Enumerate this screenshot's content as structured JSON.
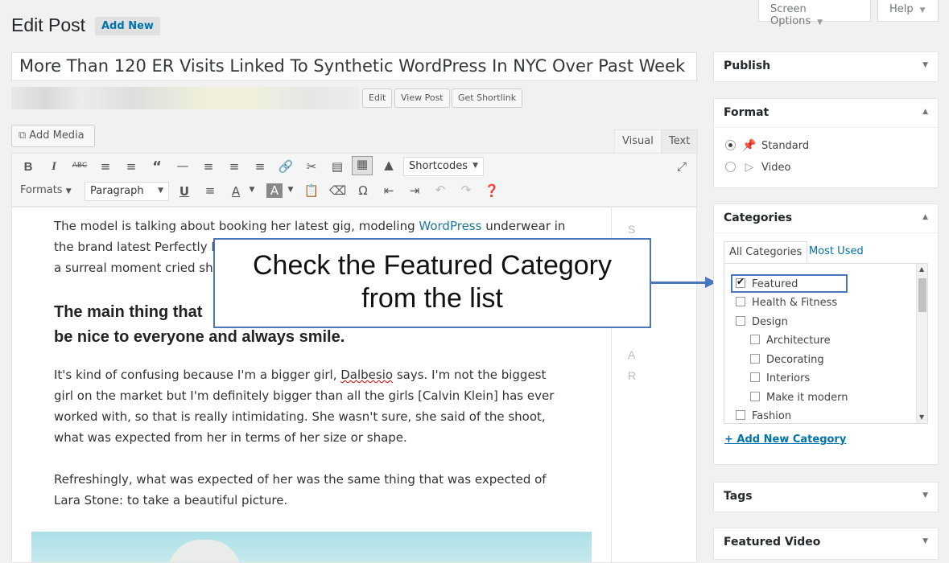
{
  "header": {
    "title": "Edit Post",
    "add_new": "Add New",
    "screen_options": "Screen Options",
    "help": "Help"
  },
  "post": {
    "title": "More Than 120 ER Visits Linked To Synthetic WordPress In NYC Over Past Week",
    "buttons": {
      "edit": "Edit",
      "view": "View Post",
      "shortlink": "Get Shortlink"
    }
  },
  "editor": {
    "add_media": "Add Media",
    "tabs": {
      "visual": "Visual",
      "text": "Text"
    },
    "toolbar": {
      "shortcodes": "Shortcodes",
      "formats": "Formats",
      "paragraph": "Paragraph"
    },
    "side_letters": [
      "S",
      "",
      "",
      "",
      "",
      "",
      "A",
      "R"
    ],
    "content": {
      "p1_a": "The model is talking about booking her latest gig, modeling ",
      "p1_link": "WordPress",
      "p1_b": " underwear in",
      "p1_line2": "the brand latest Perfectly F",
      "p1_line3": "a surreal moment cried she",
      "h_line1": "The main thing that",
      "h_line2": "be nice to everyone and always smile.",
      "p2_a": "It's kind of confusing because I'm a bigger girl, ",
      "p2_name": "Dalbesio",
      "p2_b": " says. I'm not the biggest girl on the market but I'm definitely bigger than all the girls [Calvin Klein] has ever worked with, so that is really intimidating. She wasn't sure, she said of the shoot, what was expected from her in terms of her size or shape.",
      "p3": "Refreshingly, what was expected of her was the same thing that was expected of Lara Stone: to take a beautiful picture."
    }
  },
  "callout": {
    "line1": "Check the Featured Category",
    "line2": "from the list",
    "color": "#4a76c0"
  },
  "sidebar": {
    "publish": "Publish",
    "format": {
      "title": "Format",
      "options": [
        {
          "label": "Standard",
          "selected": true,
          "icon": "pin-icon"
        },
        {
          "label": "Video",
          "selected": false,
          "icon": "video-icon"
        }
      ]
    },
    "categories": {
      "title": "Categories",
      "tab_all": "All Categories",
      "tab_used": "Most Used",
      "items": [
        {
          "label": "Featured",
          "checked": true,
          "indent": 0
        },
        {
          "label": "Health & Fitness",
          "checked": false,
          "indent": 0
        },
        {
          "label": "Design",
          "checked": false,
          "indent": 0
        },
        {
          "label": "Architecture",
          "checked": false,
          "indent": 1
        },
        {
          "label": "Decorating",
          "checked": false,
          "indent": 1
        },
        {
          "label": "Interiors",
          "checked": false,
          "indent": 1
        },
        {
          "label": "Make it modern",
          "checked": false,
          "indent": 1
        },
        {
          "label": "Fashion",
          "checked": false,
          "indent": 0
        }
      ],
      "add_new": "+ Add New Category"
    },
    "tags": "Tags",
    "featured_video": "Featured Video"
  }
}
